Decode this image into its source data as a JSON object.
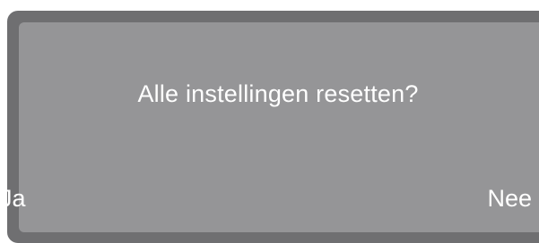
{
  "dialog": {
    "message": "Alle instellingen resetten?",
    "confirm_label": "Ja",
    "cancel_label": "Nee"
  },
  "colors": {
    "bezel": "#6f6f71",
    "screen": "#959597",
    "text": "#ffffff"
  }
}
